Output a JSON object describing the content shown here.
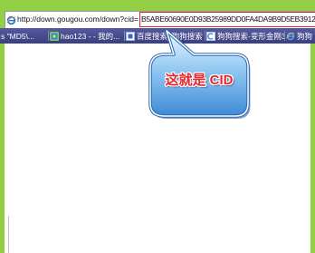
{
  "address_bar": {
    "icon": "ie-icon",
    "url_prefix": "http://down.gougou.com/down?cid=",
    "cid_value": "B5ABE60690E0D93B25989DD0FA4DA9B9D5EB3912"
  },
  "bookmarks_bar": {
    "items": [
      {
        "label": "s \"MD5\\..."
      },
      {
        "label": "hao123 - - 我的...",
        "icon": "hao123-icon"
      },
      {
        "label": "百度搜索_狗狗搜索",
        "icon": "baidu-page-icon"
      },
      {
        "label": "狗狗搜索-变形金刚3",
        "icon": "gougou-page-icon"
      },
      {
        "label": "狗狗",
        "icon": "ie-icon"
      }
    ]
  },
  "callout": {
    "text": "这就是 CID"
  },
  "colors": {
    "frame_green": "#92cf45",
    "highlight_red": "#e02424",
    "bookmarks_bar": "#3a3f7c",
    "callout_blue": "#3d8ad6",
    "callout_text": "#e8262c"
  }
}
